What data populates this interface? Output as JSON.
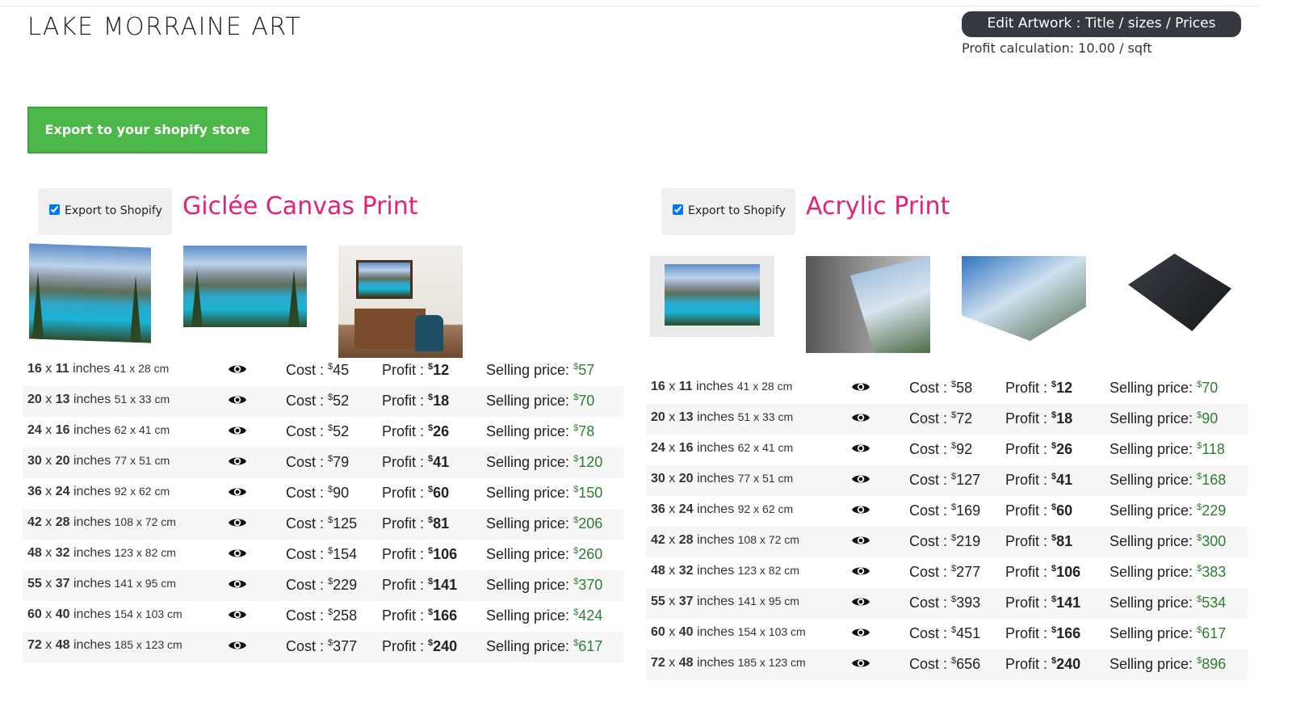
{
  "header": {
    "brand": "LAKE MORRAINE ART",
    "edit_button": "Edit Artwork : Title / sizes / Prices",
    "profit_calc": "Profit calculation: 10.00 / sqft"
  },
  "export_button": "Export to your shopify store",
  "colors": {
    "accent": "#e4217a",
    "export_green": "#4cb84a",
    "price_green": "#2e7d32",
    "edit_bg": "#343a40"
  },
  "sections": [
    {
      "title": "Giclée Canvas Print",
      "checkbox_label": "Export to Shopify",
      "checked": true,
      "rows": [
        {
          "w": "16",
          "h": "11",
          "unit": "inches",
          "cm": "41 x 28 cm",
          "cost": "45",
          "profit": "12",
          "price": "57"
        },
        {
          "w": "20",
          "h": "13",
          "unit": "inches",
          "cm": "51 x 33 cm",
          "cost": "52",
          "profit": "18",
          "price": "70"
        },
        {
          "w": "24",
          "h": "16",
          "unit": "inches",
          "cm": "62 x 41 cm",
          "cost": "52",
          "profit": "26",
          "price": "78"
        },
        {
          "w": "30",
          "h": "20",
          "unit": "inches",
          "cm": "77 x 51 cm",
          "cost": "79",
          "profit": "41",
          "price": "120"
        },
        {
          "w": "36",
          "h": "24",
          "unit": "inches",
          "cm": "92 x 62 cm",
          "cost": "90",
          "profit": "60",
          "price": "150"
        },
        {
          "w": "42",
          "h": "28",
          "unit": "inches",
          "cm": "108 x 72 cm",
          "cost": "125",
          "profit": "81",
          "price": "206"
        },
        {
          "w": "48",
          "h": "32",
          "unit": "inches",
          "cm": "123 x 82 cm",
          "cost": "154",
          "profit": "106",
          "price": "260"
        },
        {
          "w": "55",
          "h": "37",
          "unit": "inches",
          "cm": "141 x 95 cm",
          "cost": "229",
          "profit": "141",
          "price": "370"
        },
        {
          "w": "60",
          "h": "40",
          "unit": "inches",
          "cm": "154 x 103 cm",
          "cost": "258",
          "profit": "166",
          "price": "424"
        },
        {
          "w": "72",
          "h": "48",
          "unit": "inches",
          "cm": "185 x 123 cm",
          "cost": "377",
          "profit": "240",
          "price": "617"
        }
      ]
    },
    {
      "title": "Acrylic Print",
      "checkbox_label": "Export to Shopify",
      "checked": true,
      "rows": [
        {
          "w": "16",
          "h": "11",
          "unit": "inches",
          "cm": "41 x 28 cm",
          "cost": "58",
          "profit": "12",
          "price": "70"
        },
        {
          "w": "20",
          "h": "13",
          "unit": "inches",
          "cm": "51 x 33 cm",
          "cost": "72",
          "profit": "18",
          "price": "90"
        },
        {
          "w": "24",
          "h": "16",
          "unit": "inches",
          "cm": "62 x 41 cm",
          "cost": "92",
          "profit": "26",
          "price": "118"
        },
        {
          "w": "30",
          "h": "20",
          "unit": "inches",
          "cm": "77 x 51 cm",
          "cost": "127",
          "profit": "41",
          "price": "168"
        },
        {
          "w": "36",
          "h": "24",
          "unit": "inches",
          "cm": "92 x 62 cm",
          "cost": "169",
          "profit": "60",
          "price": "229"
        },
        {
          "w": "42",
          "h": "28",
          "unit": "inches",
          "cm": "108 x 72 cm",
          "cost": "219",
          "profit": "81",
          "price": "300"
        },
        {
          "w": "48",
          "h": "32",
          "unit": "inches",
          "cm": "123 x 82 cm",
          "cost": "277",
          "profit": "106",
          "price": "383"
        },
        {
          "w": "55",
          "h": "37",
          "unit": "inches",
          "cm": "141 x 95 cm",
          "cost": "393",
          "profit": "141",
          "price": "534"
        },
        {
          "w": "60",
          "h": "40",
          "unit": "inches",
          "cm": "154 x 103 cm",
          "cost": "451",
          "profit": "166",
          "price": "617"
        },
        {
          "w": "72",
          "h": "48",
          "unit": "inches",
          "cm": "185 x 123 cm",
          "cost": "656",
          "profit": "240",
          "price": "896"
        }
      ]
    }
  ],
  "labels": {
    "cost": "Cost : ",
    "profit": "Profit : ",
    "price": "Selling price: ",
    "currency": "$",
    "x": " x "
  }
}
